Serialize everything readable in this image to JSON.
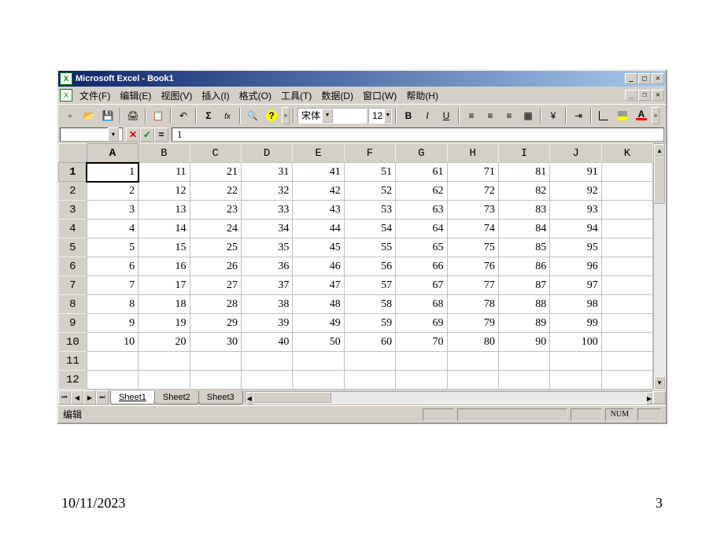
{
  "title": "Microsoft Excel - Book1",
  "menu": [
    "文件(F)",
    "编辑(E)",
    "视图(V)",
    "插入(I)",
    "格式(O)",
    "工具(T)",
    "数据(D)",
    "窗口(W)",
    "帮助(H)"
  ],
  "toolbar": {
    "font_name": "宋体",
    "font_size": "12",
    "bold": "B",
    "italic": "I",
    "underline": "U"
  },
  "formula_bar": {
    "name_box": "",
    "value": "1"
  },
  "columns": [
    "A",
    "B",
    "C",
    "D",
    "E",
    "F",
    "G",
    "H",
    "I",
    "J",
    "K"
  ],
  "active_col": 0,
  "row_headers": [
    "1",
    "2",
    "3",
    "4",
    "5",
    "6",
    "7",
    "8",
    "9",
    "10",
    "11",
    "12"
  ],
  "active_row": 0,
  "cells": [
    [
      "1",
      "11",
      "21",
      "31",
      "41",
      "51",
      "61",
      "71",
      "81",
      "91",
      ""
    ],
    [
      "2",
      "12",
      "22",
      "32",
      "42",
      "52",
      "62",
      "72",
      "82",
      "92",
      ""
    ],
    [
      "3",
      "13",
      "23",
      "33",
      "43",
      "53",
      "63",
      "73",
      "83",
      "93",
      ""
    ],
    [
      "4",
      "14",
      "24",
      "34",
      "44",
      "54",
      "64",
      "74",
      "84",
      "94",
      ""
    ],
    [
      "5",
      "15",
      "25",
      "35",
      "45",
      "55",
      "65",
      "75",
      "85",
      "95",
      ""
    ],
    [
      "6",
      "16",
      "26",
      "36",
      "46",
      "56",
      "66",
      "76",
      "86",
      "96",
      ""
    ],
    [
      "7",
      "17",
      "27",
      "37",
      "47",
      "57",
      "67",
      "77",
      "87",
      "97",
      ""
    ],
    [
      "8",
      "18",
      "28",
      "38",
      "48",
      "58",
      "68",
      "78",
      "88",
      "98",
      ""
    ],
    [
      "9",
      "19",
      "29",
      "39",
      "49",
      "59",
      "69",
      "79",
      "89",
      "99",
      ""
    ],
    [
      "10",
      "20",
      "30",
      "40",
      "50",
      "60",
      "70",
      "80",
      "90",
      "100",
      ""
    ],
    [
      "",
      "",
      "",
      "",
      "",
      "",
      "",
      "",
      "",
      "",
      ""
    ],
    [
      "",
      "",
      "",
      "",
      "",
      "",
      "",
      "",
      "",
      "",
      ""
    ]
  ],
  "sheet_tabs": [
    "Sheet1",
    "Sheet2",
    "Sheet3"
  ],
  "active_sheet": 0,
  "status": {
    "mode": "编辑",
    "num": "NUM"
  },
  "footer": {
    "date": "10/11/2023",
    "page": "3"
  }
}
